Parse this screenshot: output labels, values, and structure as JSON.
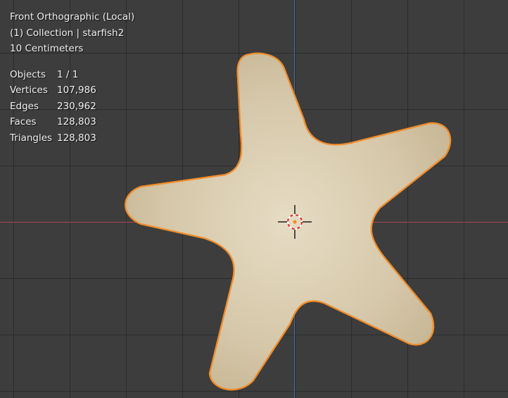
{
  "viewport": {
    "view_name": "Front Orthographic (Local)",
    "collection_info": "(1) Collection | starfish2",
    "grid_scale": "10 Centimeters",
    "colors": {
      "background": "#3d3d3d",
      "grid": "#2f2f2f",
      "x_axis": "#b2434f",
      "z_axis": "#3d6fae",
      "selection_outline": "#f28c28",
      "object": "#d8cbb0"
    }
  },
  "stats": [
    {
      "label": "Objects",
      "value": "1 / 1"
    },
    {
      "label": "Vertices",
      "value": "107,986"
    },
    {
      "label": "Edges",
      "value": "230,962"
    },
    {
      "label": "Faces",
      "value": "128,803"
    },
    {
      "label": "Triangles",
      "value": "128,803"
    }
  ],
  "scene": {
    "selected_object": "starfish2",
    "tool": "3d-cursor"
  }
}
